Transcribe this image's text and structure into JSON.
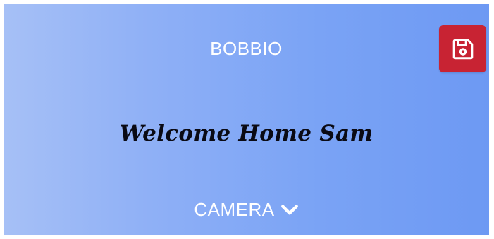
{
  "header": {
    "title": "BOBBIO"
  },
  "toolbar": {
    "save_icon": "floppy-disk-icon",
    "save_color": "#c82333"
  },
  "main": {
    "greeting": "Welcome Home Sam"
  },
  "camera": {
    "label": "CAMERA",
    "dropdown_icon": "chevron-down-icon"
  },
  "colors": {
    "background_gradient_start": "#a6c0f6",
    "background_gradient_end": "#6d99f3",
    "text": "#ffffff",
    "greeting_text": "#0a0a14"
  }
}
